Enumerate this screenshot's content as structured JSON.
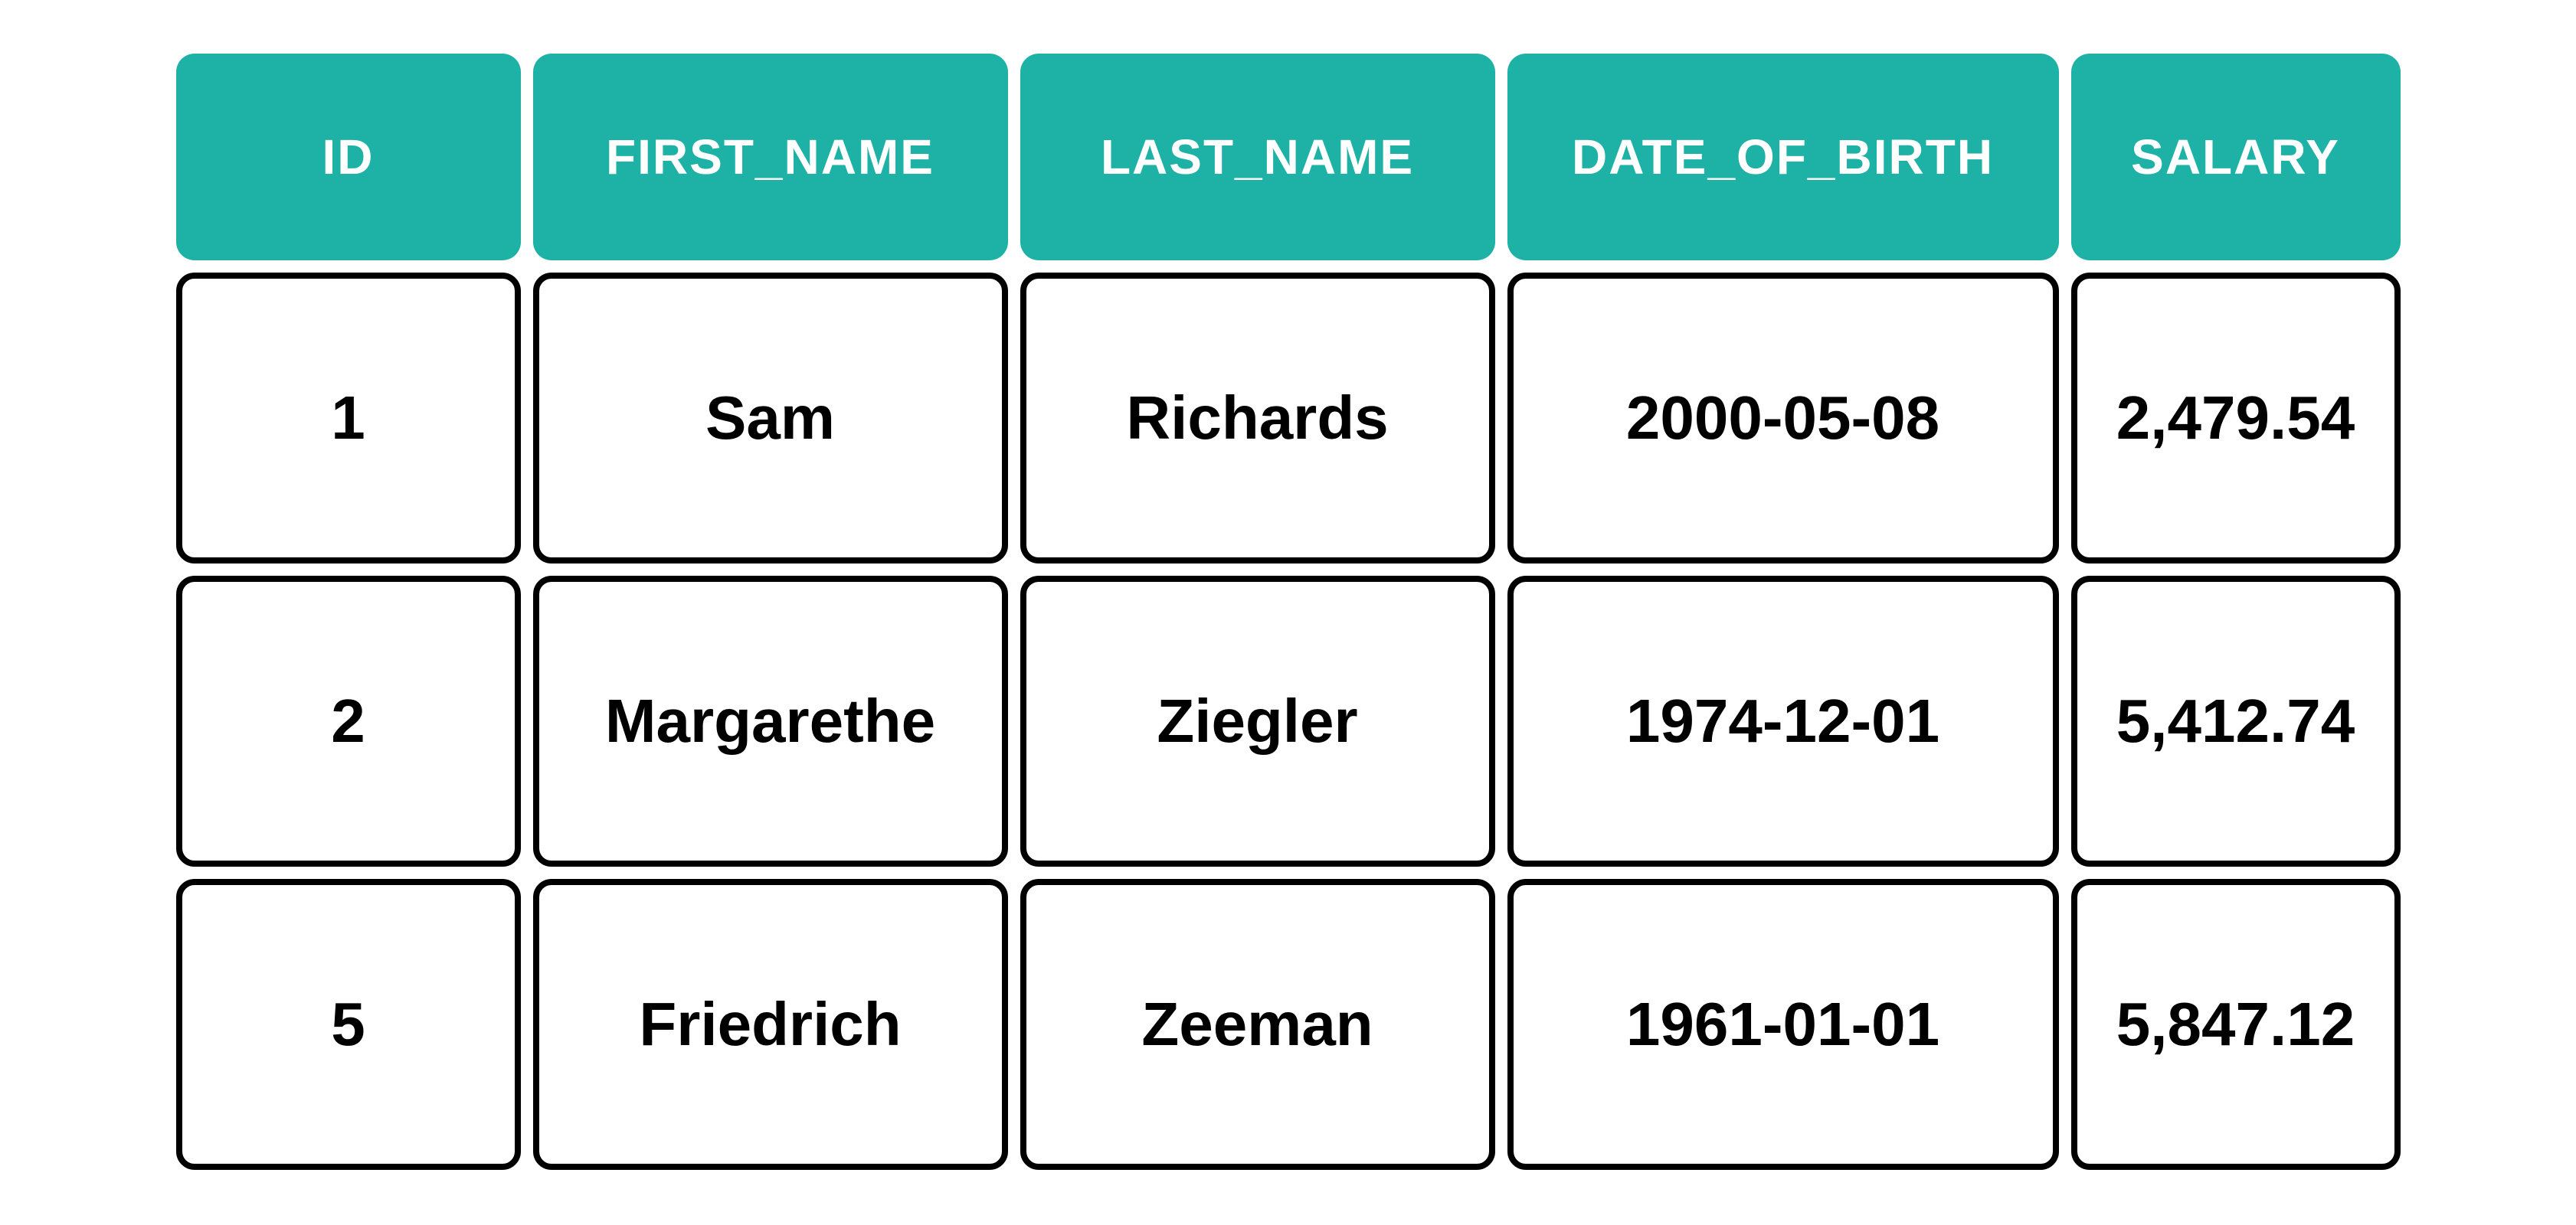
{
  "table": {
    "headers": [
      "ID",
      "FIRST_NAME",
      "LAST_NAME",
      "DATE_OF_BIRTH",
      "SALARY"
    ],
    "rows": [
      {
        "id": "1",
        "first_name": "Sam",
        "last_name": "Richards",
        "date_of_birth": "2000-05-08",
        "salary": "2,479.54"
      },
      {
        "id": "2",
        "first_name": "Margarethe",
        "last_name": "Ziegler",
        "date_of_birth": "1974-12-01",
        "salary": "5,412.74"
      },
      {
        "id": "5",
        "first_name": "Friedrich",
        "last_name": "Zeeman",
        "date_of_birth": "1961-01-01",
        "salary": "5,847.12"
      }
    ]
  },
  "colors": {
    "header_bg": "#1eb2a6",
    "header_fg": "#ffffff",
    "cell_border": "#000000",
    "cell_bg": "#ffffff",
    "cell_fg": "#000000"
  }
}
